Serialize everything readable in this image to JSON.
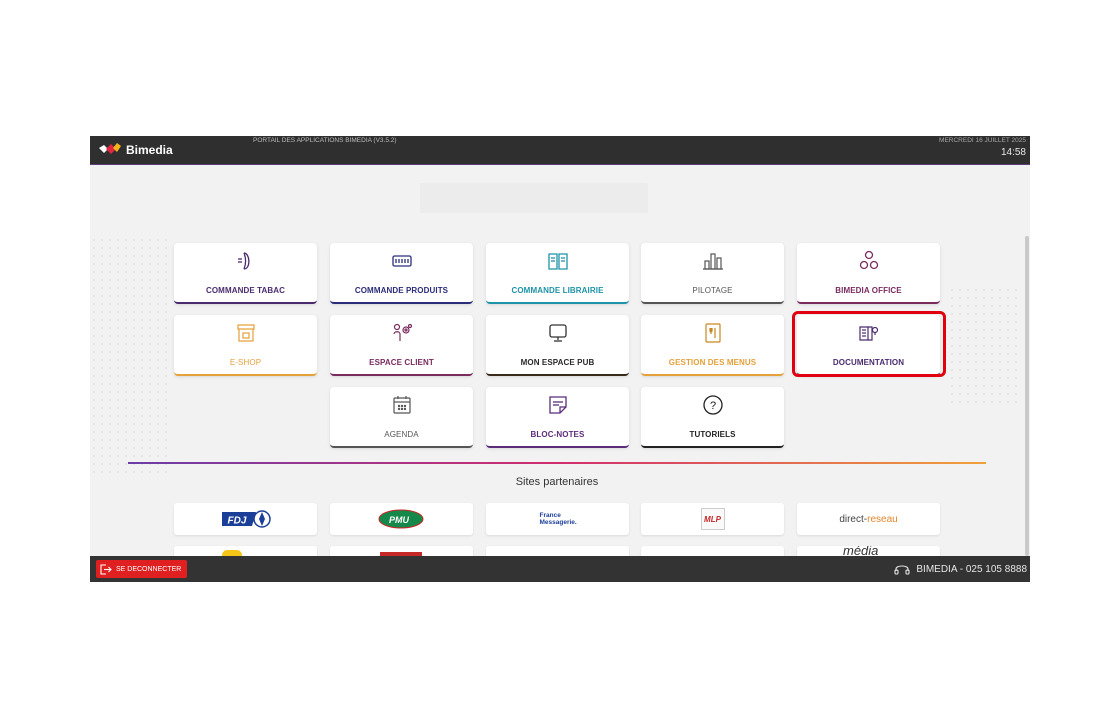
{
  "header": {
    "logo_text": "Bimedia",
    "portal_title": "PORTAIL DES APPLICATIONS BIMEDIA (V3.5.2)",
    "date": "MERCREDI 16 JUILLET 2025",
    "time": "14:58"
  },
  "tiles": [
    {
      "label": "COMMANDE TABAC",
      "icon": "tabac-cone-icon",
      "color": "#4a2c6e"
    },
    {
      "label": "COMMANDE PRODUITS",
      "icon": "keyboard-icon",
      "color": "#2b2d7a"
    },
    {
      "label": "COMMANDE LIBRAIRIE",
      "icon": "open-book-icon",
      "color": "#1f93a8"
    },
    {
      "label": "PILOTAGE",
      "icon": "bar-chart-icon",
      "color": "#555555"
    },
    {
      "label": "BIMEDIA OFFICE",
      "icon": "molecule-icon",
      "color": "#7a2b5e"
    },
    {
      "label": "E-SHOP",
      "icon": "shop-basket-icon",
      "color": "#e5a13a"
    },
    {
      "label": "ESPACE CLIENT",
      "icon": "client-gears-icon",
      "color": "#7a2b5e"
    },
    {
      "label": "MON ESPACE PUB",
      "icon": "monitor-icon",
      "color": "#3a2a1a"
    },
    {
      "label": "GESTION DES MENUS",
      "icon": "menu-card-icon",
      "color": "#e5a13a"
    },
    {
      "label": "DOCUMENTATION",
      "icon": "documentation-book-icon",
      "color": "#4a2c6e"
    },
    {
      "label": "AGENDA",
      "icon": "calendar-icon",
      "color": "#555555"
    },
    {
      "label": "BLOC-NOTES",
      "icon": "notepad-icon",
      "color": "#5a2c7a"
    },
    {
      "label": "TUTORIELS",
      "icon": "question-circle-icon",
      "color": "#222222"
    }
  ],
  "partners_title": "Sites partenaires",
  "partners": [
    {
      "label": "FDJ",
      "icon": "fdj-logo"
    },
    {
      "label": "PMU",
      "icon": "pmu-logo"
    },
    {
      "label": "France Messagerie.",
      "icon": "france-messagerie-logo"
    },
    {
      "label": "MLP",
      "icon": "mlp-logo"
    },
    {
      "label_a": "direct-",
      "label_b": "reseau",
      "icon": "direct-reseau-logo"
    }
  ],
  "partial_partner_text": "média",
  "footer": {
    "logout_label": "SE DECONNECTER",
    "support_label": "BIMEDIA - 025 105 8888"
  },
  "colors": {
    "accent_red": "#e02020",
    "topbar": "#2f2f2f",
    "highlight": "#e10010"
  }
}
